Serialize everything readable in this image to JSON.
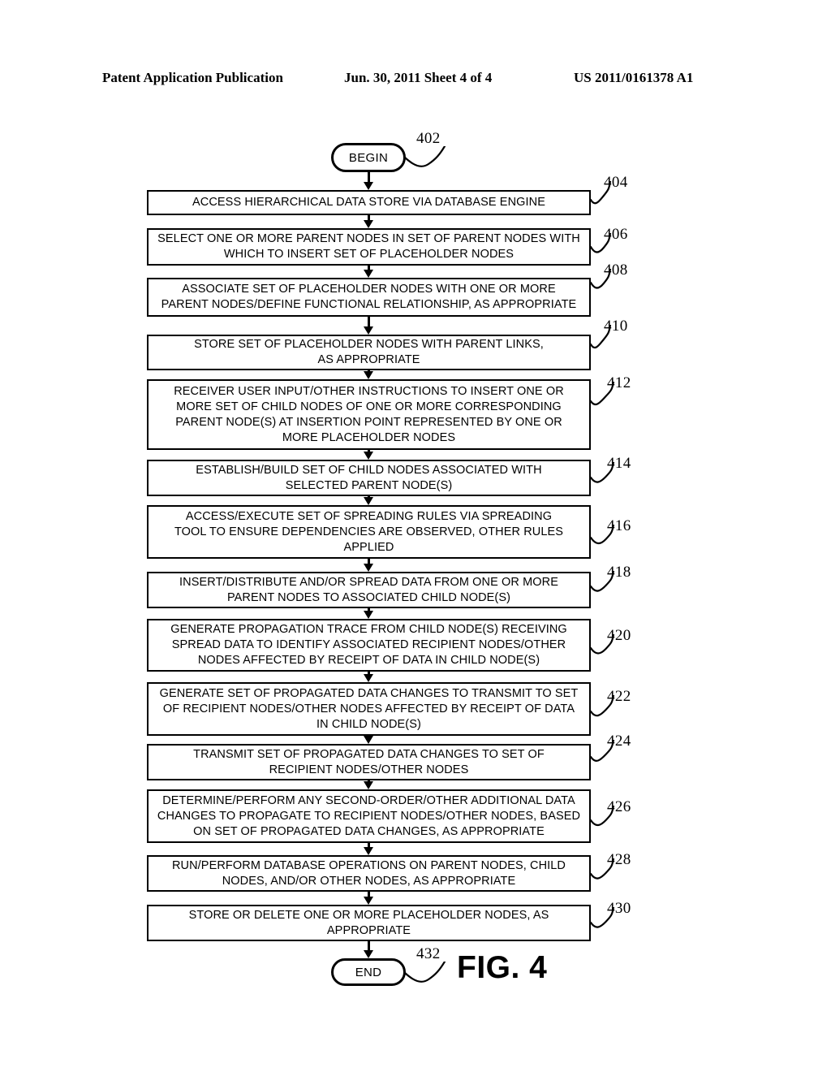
{
  "header": {
    "left": "Patent Application Publication",
    "middle": "Jun. 30, 2011  Sheet 4 of 4",
    "right": "US 2011/0161378 A1"
  },
  "figure": {
    "caption": "FIG. 4",
    "begin_label": "BEGIN",
    "begin_ref": "402",
    "end_label": "END",
    "end_ref": "432"
  },
  "steps": [
    {
      "ref": "404",
      "text": "ACCESS HIERARCHICAL DATA STORE VIA DATABASE ENGINE"
    },
    {
      "ref": "406",
      "text": "SELECT ONE OR MORE PARENT NODES IN SET OF PARENT NODES WITH\nWHICH TO INSERT SET OF PLACEHOLDER NODES"
    },
    {
      "ref": "408",
      "text": "ASSOCIATE SET OF PLACEHOLDER NODES WITH ONE OR MORE\nPARENT NODES/DEFINE FUNCTIONAL RELATIONSHIP, AS APPROPRIATE"
    },
    {
      "ref": "410",
      "text": "STORE SET OF PLACEHOLDER NODES WITH PARENT LINKS,\nAS APPROPRIATE"
    },
    {
      "ref": "412",
      "text": "RECEIVER USER INPUT/OTHER INSTRUCTIONS TO INSERT ONE OR\nMORE SET OF CHILD NODES OF ONE OR MORE CORRESPONDING\nPARENT NODE(S) AT INSERTION POINT REPRESENTED BY ONE OR\nMORE PLACEHOLDER NODES"
    },
    {
      "ref": "414",
      "text": "ESTABLISH/BUILD SET OF CHILD NODES ASSOCIATED WITH\nSELECTED PARENT NODE(S)"
    },
    {
      "ref": "416",
      "text": "ACCESS/EXECUTE SET OF SPREADING RULES VIA SPREADING\nTOOL TO ENSURE DEPENDENCIES ARE OBSERVED, OTHER RULES\nAPPLIED"
    },
    {
      "ref": "418",
      "text": "INSERT/DISTRIBUTE AND/OR SPREAD DATA FROM ONE OR MORE\nPARENT NODES TO ASSOCIATED CHILD NODE(S)"
    },
    {
      "ref": "420",
      "text": "GENERATE PROPAGATION TRACE FROM CHILD NODE(S) RECEIVING\nSPREAD DATA TO IDENTIFY ASSOCIATED RECIPIENT NODES/OTHER\nNODES AFFECTED BY RECEIPT OF DATA IN CHILD NODE(S)"
    },
    {
      "ref": "422",
      "text": "GENERATE SET OF PROPAGATED DATA CHANGES TO TRANSMIT TO SET\nOF RECIPIENT NODES/OTHER NODES AFFECTED BY RECEIPT OF DATA\nIN CHILD NODE(S)"
    },
    {
      "ref": "424",
      "text": "TRANSMIT SET OF PROPAGATED DATA CHANGES TO SET OF\nRECIPIENT NODES/OTHER NODES"
    },
    {
      "ref": "426",
      "text": "DETERMINE/PERFORM ANY SECOND-ORDER/OTHER ADDITIONAL DATA\nCHANGES TO PROPAGATE TO RECIPIENT NODES/OTHER NODES, BASED\nON SET OF PROPAGATED DATA CHANGES, AS APPROPRIATE"
    },
    {
      "ref": "428",
      "text": "RUN/PERFORM DATABASE OPERATIONS ON PARENT NODES, CHILD\nNODES, AND/OR OTHER NODES, AS APPROPRIATE"
    },
    {
      "ref": "430",
      "text": "STORE OR DELETE ONE OR MORE PLACEHOLDER NODES, AS\nAPPROPRIATE"
    }
  ]
}
